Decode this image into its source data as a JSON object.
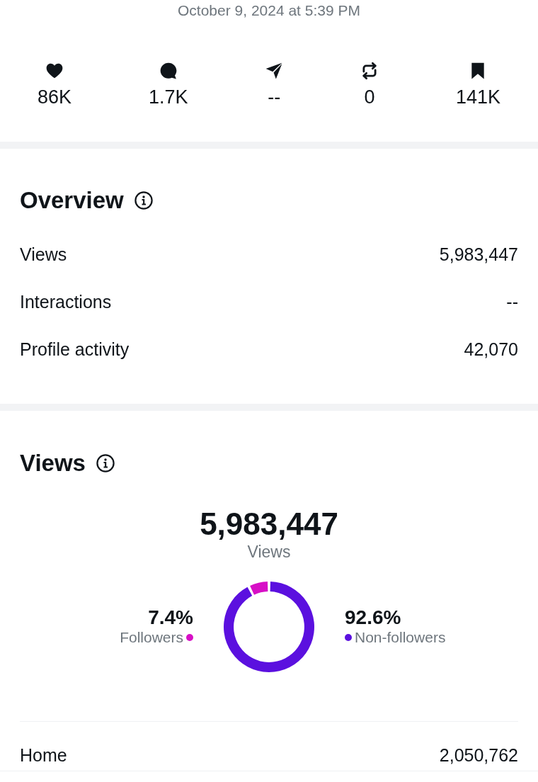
{
  "post": {
    "timestamp": "October 9, 2024 at 5:39 PM"
  },
  "engagement": [
    {
      "kind": "like",
      "value": "86K"
    },
    {
      "kind": "reply",
      "value": "1.7K"
    },
    {
      "kind": "share",
      "value": "--"
    },
    {
      "kind": "repost",
      "value": "0"
    },
    {
      "kind": "bookmark",
      "value": "141K"
    }
  ],
  "overview": {
    "title": "Overview",
    "rows": [
      {
        "label": "Views",
        "value": "5,983,447"
      },
      {
        "label": "Interactions",
        "value": "--"
      },
      {
        "label": "Profile activity",
        "value": "42,070"
      }
    ]
  },
  "views": {
    "title": "Views",
    "total": "5,983,447",
    "total_label": "Views",
    "legend": [
      {
        "share": "7.4%",
        "color": "#d70fc6"
      },
      {
        "share": "92.6%",
        "color": "#5b10df"
      }
    ],
    "chart_data": {
      "type": "donut",
      "categories": [
        "Followers",
        "Non-followers"
      ],
      "values": [
        7.4,
        92.6
      ]
    },
    "rows": [
      {
        "label": "Home",
        "value": "2,050,762"
      }
    ]
  }
}
